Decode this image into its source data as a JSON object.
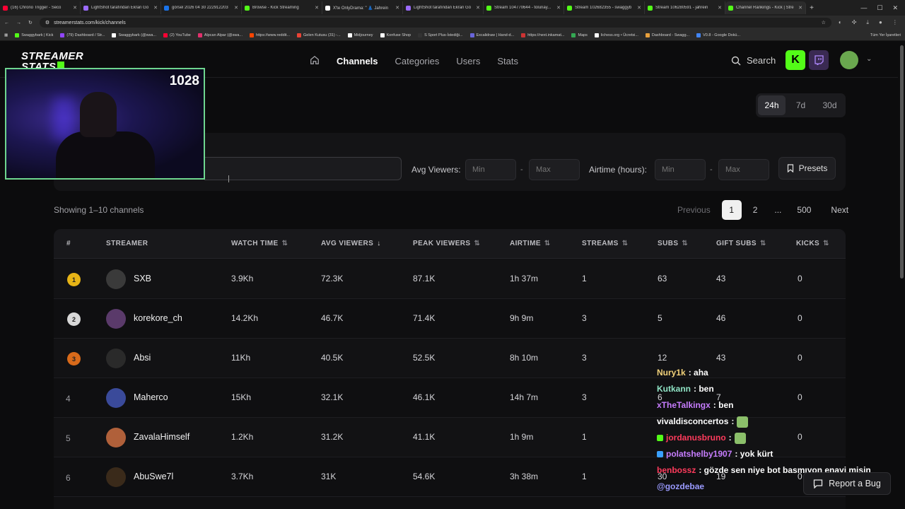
{
  "browser": {
    "tabs": [
      {
        "title": "(16) Chrono Trigger - Seco",
        "color": "#ff0033"
      },
      {
        "title": "LightShot tarafından Ekran Gö",
        "color": "#9b6bff"
      },
      {
        "title": "görsel 2026 04 30 222912203",
        "color": "#1a73e8"
      },
      {
        "title": "Browse - Kick Streaming",
        "color": "#53fc18"
      },
      {
        "title": "X'te OnlyDrama: \" 👗 Jahrein",
        "color": "#ffffff"
      },
      {
        "title": "LightShot tarafından Ekran Gö",
        "color": "#9b6bff"
      },
      {
        "title": "Stream 104770644 - tolunay...",
        "color": "#53fc18"
      },
      {
        "title": "Stream 102682355 - swaggyb",
        "color": "#53fc18"
      },
      {
        "title": "Stream 106280591 - jahrein",
        "color": "#53fc18"
      },
      {
        "title": "Channel Rankings - Kick | Stre",
        "color": "#53fc18",
        "active": true
      }
    ],
    "new_tab_label": "+",
    "url": "streamerstats.com/kick/channels",
    "bookmarks": [
      {
        "label": "Swaggybark | Kick",
        "color": "#53fc18"
      },
      {
        "label": "(79) Dashboard / Str...",
        "color": "#9146ff"
      },
      {
        "label": "Swaggybark (@swa...",
        "color": "#ffffff"
      },
      {
        "label": "(2) YouTube",
        "color": "#ff0033"
      },
      {
        "label": "Alpcan Alpar (@swa...",
        "color": "#e1306c"
      },
      {
        "label": "https://www.reddit...",
        "color": "#ff4500"
      },
      {
        "label": "Gelen Kutusu (31) -...",
        "color": "#ea4335"
      },
      {
        "label": "Midjourney",
        "color": "#ffffff"
      },
      {
        "label": "Konfuse Shop",
        "color": "#ffffff"
      },
      {
        "label": "S Sport Plus-İstediği...",
        "color": "#333333"
      },
      {
        "label": "Excalidraw | Hand-d...",
        "color": "#6965db"
      },
      {
        "label": "https://next.inkamat...",
        "color": "#cc3333"
      },
      {
        "label": "Maps",
        "color": "#34a853"
      },
      {
        "label": "lichess.org • Ücretsi...",
        "color": "#ffffff"
      },
      {
        "label": "Dashboard - Swagg...",
        "color": "#e8a03c"
      },
      {
        "label": "V0.8 - Google Dokü...",
        "color": "#4285f4"
      }
    ],
    "all_bookmarks_label": "Tüm Yer İşaretleri"
  },
  "site": {
    "logo_line1": "STREAMER",
    "logo_line2": "STATS",
    "nav": {
      "channels": "Channels",
      "categories": "Categories",
      "users": "Users",
      "stats": "Stats"
    },
    "search_label": "Search",
    "kick_glyph": "K"
  },
  "period": {
    "options": [
      "24h",
      "7d",
      "30d"
    ],
    "selected": "24h"
  },
  "filters": {
    "avg_viewers_label": "Avg Viewers:",
    "airtime_label": "Airtime (hours):",
    "min_placeholder": "Min",
    "max_placeholder": "Max",
    "dash": "-",
    "presets_label": "Presets"
  },
  "listing": {
    "showing": "Showing 1–10 channels",
    "previous": "Previous",
    "pages": [
      "1",
      "2",
      "...",
      "500"
    ],
    "next": "Next"
  },
  "table": {
    "headers": {
      "rank": "#",
      "streamer": "STREAMER",
      "watch_time": "WATCH TIME",
      "avg_viewers": "AVG VIEWERS",
      "peak_viewers": "PEAK VIEWERS",
      "airtime": "AIRTIME",
      "streams": "STREAMS",
      "subs": "SUBS",
      "gift_subs": "GIFT SUBS",
      "kicks": "KICKS"
    },
    "sort_glyph": "⇅",
    "sort_active_glyph": "↓",
    "rows": [
      {
        "rank": "1",
        "name": "SXB",
        "watch_time": "3.9Kh",
        "avg_viewers": "72.3K",
        "peak_viewers": "87.1K",
        "airtime": "1h 37m",
        "streams": "1",
        "subs": "63",
        "gift_subs": "43",
        "kicks": "0",
        "rank_color": "#e7b416",
        "avatar_color": "#3a3a3a"
      },
      {
        "rank": "2",
        "name": "korekore_ch",
        "watch_time": "14.2Kh",
        "avg_viewers": "46.7K",
        "peak_viewers": "71.4K",
        "airtime": "9h 9m",
        "streams": "3",
        "subs": "5",
        "gift_subs": "46",
        "kicks": "0",
        "rank_color": "#d8d8d8",
        "avatar_color": "#5a3a6a"
      },
      {
        "rank": "3",
        "name": "Absi",
        "watch_time": "11Kh",
        "avg_viewers": "40.5K",
        "peak_viewers": "52.5K",
        "airtime": "8h 10m",
        "streams": "3",
        "subs": "12",
        "gift_subs": "43",
        "kicks": "0",
        "rank_color": "#d86a1a",
        "avatar_color": "#2a2a2a"
      },
      {
        "rank": "4",
        "name": "Maherco",
        "watch_time": "15Kh",
        "avg_viewers": "32.1K",
        "peak_viewers": "46.1K",
        "airtime": "14h 7m",
        "streams": "3",
        "subs": "6",
        "gift_subs": "7",
        "kicks": "0",
        "rank_color": "",
        "avatar_color": "#3a4a9a"
      },
      {
        "rank": "5",
        "name": "ZavalaHimself",
        "watch_time": "1.2Kh",
        "avg_viewers": "31.2K",
        "peak_viewers": "41.1K",
        "airtime": "1h 9m",
        "streams": "1",
        "subs": "",
        "gift_subs": "",
        "kicks": "0",
        "rank_color": "",
        "avatar_color": "#b0603a"
      },
      {
        "rank": "6",
        "name": "AbuSwe7l",
        "watch_time": "3.7Kh",
        "avg_viewers": "31K",
        "peak_viewers": "54.6K",
        "airtime": "3h 38m",
        "streams": "1",
        "subs": "30",
        "gift_subs": "19",
        "kicks": "0",
        "rank_color": "",
        "avatar_color": "#3a2a1a"
      }
    ]
  },
  "webcam": {
    "viewer_count": "1028"
  },
  "chat": [
    {
      "user": "Nury1k",
      "text": ": aha",
      "color": "#f2d27a"
    },
    {
      "user": "Kutkann",
      "text": ": ben",
      "color": "#8fe3c4"
    },
    {
      "user": "xTheTalkingx",
      "text": ": ben",
      "color": "#c77dff"
    },
    {
      "user": "vivaldisconcertos",
      "text": ":",
      "color": "#ffffff",
      "emote": true
    },
    {
      "user": "jordanusbruno",
      "text": ":",
      "color": "#ff3b5c",
      "emote": true,
      "badge_color": "#53fc18"
    },
    {
      "user": "polatshelby1907",
      "text": ": yok kürt",
      "color": "#c77dff",
      "badge_color": "#3aa0ff"
    },
    {
      "user": "benbossz",
      "text": ": gözde sen niye bot basmıyon enayi misin",
      "color": "#ff3b5c"
    },
    {
      "user": "@gozdebae",
      "text": "",
      "color": "#9a9aff"
    }
  ],
  "report_bug_label": "Report a Bug",
  "colors": {
    "accent": "#53fc18",
    "background": "#0c0c0d"
  }
}
